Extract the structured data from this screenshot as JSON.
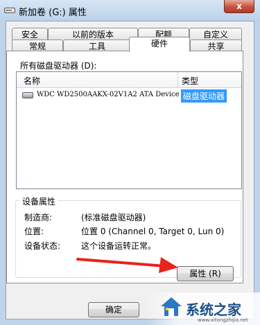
{
  "window": {
    "title": "新加卷 (G:) 属性",
    "close_glyph": "x"
  },
  "tabs_back": [
    "安全",
    "以前的版本",
    "配额",
    "自定义"
  ],
  "tabs_front": [
    "常规",
    "工具",
    "硬件",
    "共享"
  ],
  "active_tab": "硬件",
  "hardware": {
    "list_label": "所有磁盘驱动器 (D):",
    "columns": [
      "名称",
      "类型"
    ],
    "rows": [
      {
        "name": "WDC WD2500AAKX-02V1A2 ATA Device",
        "type": "磁盘驱动器",
        "icon": "hard-drive-icon"
      }
    ]
  },
  "device_properties": {
    "legend": "设备属性",
    "fields": [
      {
        "label": "制造商:",
        "value": "(标准磁盘驱动器)"
      },
      {
        "label": "位置:",
        "value": "位置 0 (Channel 0, Target 0, Lun 0)"
      },
      {
        "label": "设备状态:",
        "value": "这个设备运转正常。"
      }
    ],
    "properties_button": "属性 (R)"
  },
  "footer": {
    "ok_button": "确定"
  },
  "watermark": {
    "text": "系统之家",
    "sub": "www.xitongzhijia.net"
  },
  "colors": {
    "title_bar": "#bcd1ea",
    "close_button": "#c7523c",
    "selection": "#3399ff",
    "arrow": "#e8231d"
  }
}
